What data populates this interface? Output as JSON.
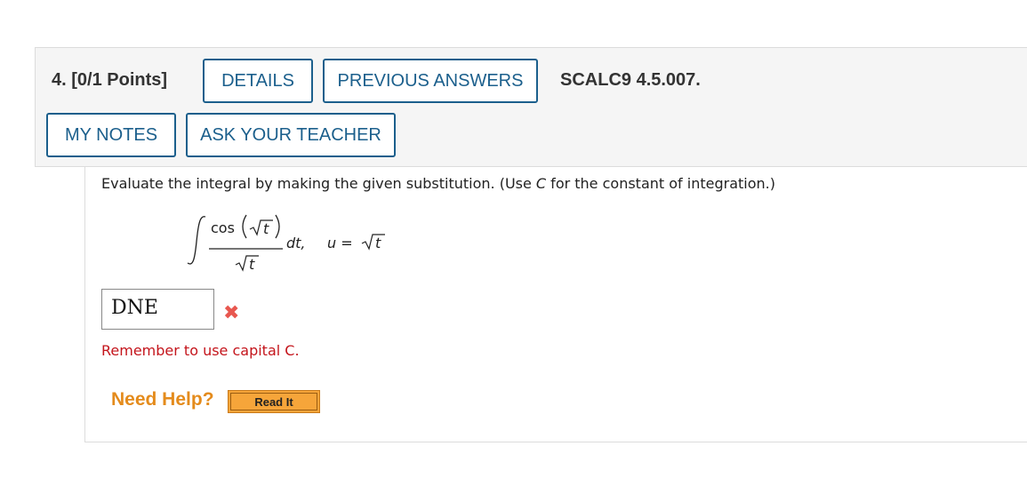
{
  "question": {
    "number": "4.",
    "points": "[0/1 Points]",
    "code": "SCALC9 4.5.007."
  },
  "buttons": {
    "details": "DETAILS",
    "previous_answers": "PREVIOUS ANSWERS",
    "my_notes": "MY NOTES",
    "ask_teacher": "ASK YOUR TEACHER"
  },
  "prompt": {
    "before": "Evaluate the integral by making the given substitution. (Use ",
    "var": "C",
    "after": " for the constant of integration.)"
  },
  "math": {
    "cos": "cos",
    "t": "t",
    "dt": "dt,",
    "u_eq": "u ="
  },
  "answer": {
    "value": "DNE",
    "status_icon": "x-mark-icon"
  },
  "feedback": "Remember to use capital C.",
  "help": {
    "label": "Need Help?",
    "read_it": "Read It"
  },
  "colors": {
    "button_border": "#1b5f8c",
    "error": "#c4151c",
    "help": "#e48b1c"
  }
}
